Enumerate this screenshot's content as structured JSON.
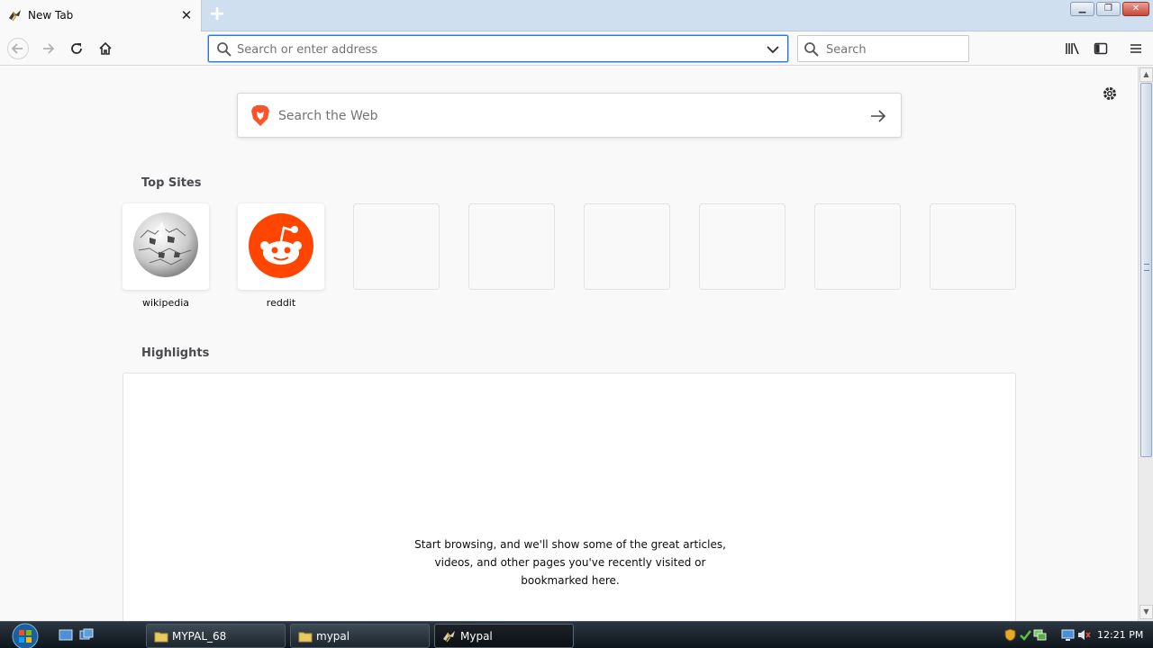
{
  "tab": {
    "title": "New Tab",
    "close_glyph": "✕",
    "new_tab_glyph": "+"
  },
  "window_controls": {
    "minimize_glyph": "▁",
    "restore_glyph": "❐",
    "close_glyph": "✕"
  },
  "navbar": {
    "url_placeholder": "Search or enter address",
    "search_placeholder": "Search"
  },
  "content": {
    "web_search_placeholder": "Search the Web",
    "top_sites_title": "Top Sites",
    "top_sites": [
      {
        "label": "wikipedia",
        "icon": "wikipedia-globe-icon"
      },
      {
        "label": "reddit",
        "icon": "reddit-alien-icon"
      },
      {
        "label": ""
      },
      {
        "label": ""
      },
      {
        "label": ""
      },
      {
        "label": ""
      },
      {
        "label": ""
      },
      {
        "label": ""
      }
    ],
    "highlights_title": "Highlights",
    "highlights_empty": [
      "Start browsing, and we'll show some of the great articles,",
      "videos, and other pages you've recently visited or",
      "bookmarked here."
    ]
  },
  "taskbar": {
    "buttons": [
      {
        "label": "MYPAL_68",
        "icon": "folder-icon"
      },
      {
        "label": "mypal",
        "icon": "folder-icon"
      },
      {
        "label": "Mypal",
        "icon": "mypal-icon"
      }
    ],
    "clock": "12:21 PM"
  },
  "colors": {
    "accent": "#2a7ac5",
    "reddit": "#ff4500",
    "brave": "#fb542b"
  }
}
